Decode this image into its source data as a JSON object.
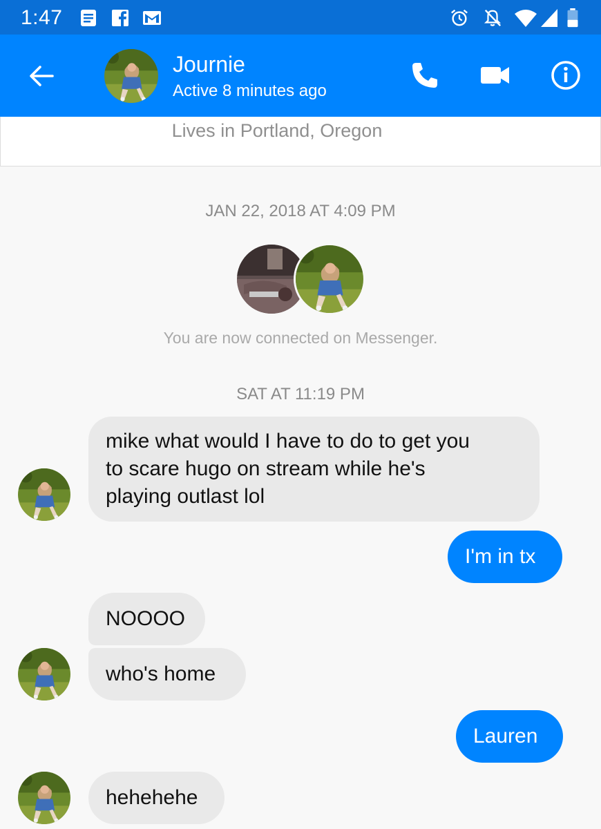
{
  "status_bar": {
    "time": "1:47",
    "icons": [
      "notes-icon",
      "facebook-icon",
      "gmail-icon",
      "alarm-icon",
      "bell-off-icon",
      "wifi-icon",
      "signal-icon",
      "battery-icon"
    ]
  },
  "header": {
    "name": "Journie",
    "status": "Active 8 minutes ago",
    "actions": [
      "phone-icon",
      "video-icon",
      "info-icon"
    ]
  },
  "profile": {
    "location": "Lives in Portland, Oregon"
  },
  "timestamps": {
    "first": "JAN 22, 2018 AT 4:09 PM",
    "second": "SAT AT 11:19 PM"
  },
  "connected_text": "You are now connected on Messenger.",
  "messages": [
    {
      "from": "them",
      "lines": [
        "mike what would I have to do to get you",
        "to scare hugo on stream while he's",
        "playing outlast lol"
      ]
    },
    {
      "from": "me",
      "text": "I'm in tx"
    },
    {
      "from": "them",
      "text": "NOOOO"
    },
    {
      "from": "them",
      "text": "who's home"
    },
    {
      "from": "me",
      "text": "Lauren"
    },
    {
      "from": "them",
      "text": "hehehehe"
    }
  ],
  "colors": {
    "status_bar": "#0a6fd6",
    "app_bar": "#0084ff",
    "outgoing_bubble": "#0084ff",
    "incoming_bubble": "#e9e9e9"
  }
}
